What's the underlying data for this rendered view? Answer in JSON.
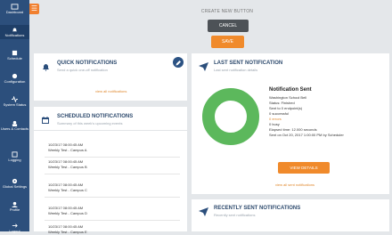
{
  "sidebar": {
    "items": [
      {
        "label": "Dashboard",
        "icon": "dashboard-icon"
      },
      {
        "label": "Notifications",
        "icon": "bell-icon"
      },
      {
        "label": "Schedule",
        "icon": "calendar-icon"
      },
      {
        "label": "Configuration",
        "icon": "gear-icon"
      },
      {
        "label": "System Status",
        "icon": "status-icon"
      },
      {
        "label": "Users & Contacts",
        "icon": "users-icon"
      },
      {
        "label": "Logging",
        "icon": "log-icon"
      },
      {
        "label": "Global Settings",
        "icon": "settings-icon"
      },
      {
        "label": "Profile",
        "icon": "profile-icon"
      },
      {
        "label": "Logout",
        "icon": "logout-icon"
      }
    ]
  },
  "create": {
    "title": "CREATE NEW BUTTON",
    "cancel_label": "CANCEL",
    "save_label": "SAVE"
  },
  "quick": {
    "title": "QUICK NOTIFICATIONS",
    "subtitle": "Send a quick one-off notification",
    "link": "view all notifications"
  },
  "scheduled": {
    "title": "SCHEDULED NOTIFICATIONS",
    "subtitle": "Summary of this week's upcoming events",
    "items": [
      {
        "datetime": "10/23/17 08:00:45 AM",
        "name": "Weekly Test - Campus A"
      },
      {
        "datetime": "10/23/17 08:00:45 AM",
        "name": "Weekly Test - Campus B"
      },
      {
        "datetime": "10/23/17 08:00:45 AM",
        "name": "Weekly Test - Campus C"
      },
      {
        "datetime": "10/23/17 08:00:45 AM",
        "name": "Weekly Test - Campus D"
      },
      {
        "datetime": "10/23/17 08:00:45 AM",
        "name": "Weekly Test - Campus E"
      }
    ]
  },
  "last_sent": {
    "title": "LAST SENT NOTIFICATION",
    "subtitle": "Last sent notification details",
    "detail_title": "Notification Sent",
    "lines": [
      "Washington School Bell",
      "Status: Finished",
      "Sent to 0 endpoint(s)",
      "0 successful",
      "0 errors",
      "0 busy",
      "Elapsed time: 12.000 seconds",
      "Sent on Oct 20, 2017 1:00:00 PM by Scheduler"
    ],
    "errors_color": "#e0892f",
    "donut_color": "#5cb85c",
    "view_details_label": "VIEW DETAILS",
    "link": "view all sent notifications"
  },
  "recent": {
    "title": "RECENTLY SENT NOTIFICATIONS",
    "subtitle": "Recently sent notifications"
  },
  "colors": {
    "sidebar": "#2c4f7c",
    "accent": "#f08a2b",
    "cancel": "#4d5257",
    "background": "#e4e7ea"
  }
}
